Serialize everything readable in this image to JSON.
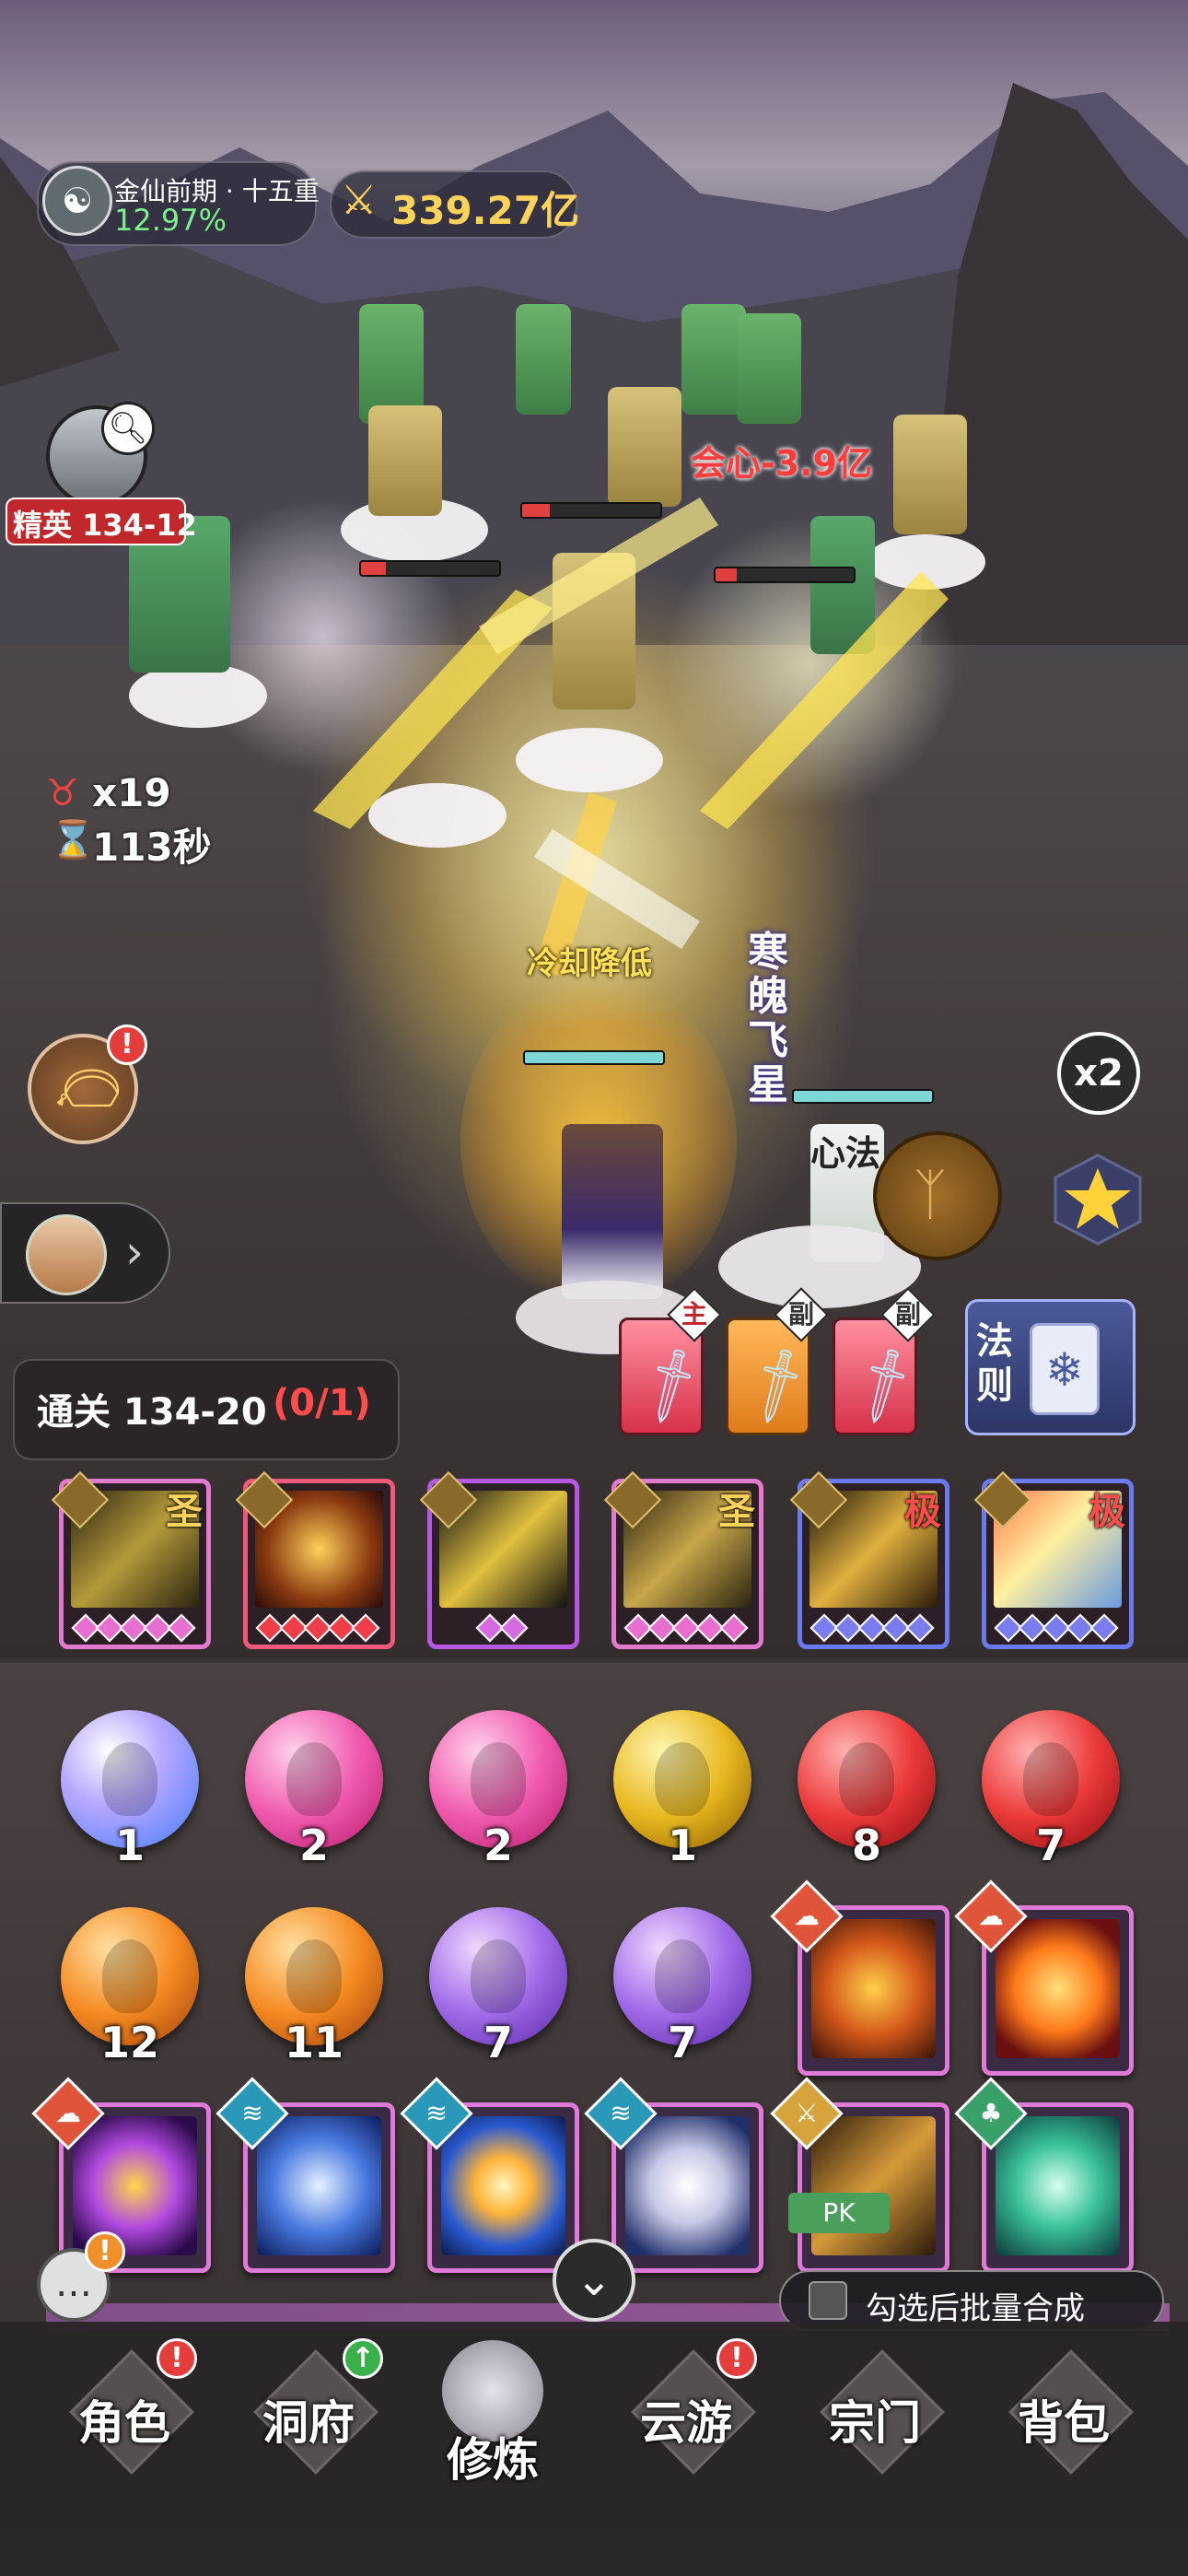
{
  "player": {
    "realm": "金仙前期 · 十五重",
    "progress": "12.97%",
    "power": "339.27亿"
  },
  "stage": {
    "elite_label": "精英 134-12",
    "enemy_count": "x19",
    "timer": "113秒",
    "clear_label": "通关 134-20",
    "clear_progress": "(0/1)"
  },
  "battle": {
    "crit_text": "会心-3.9亿",
    "buff_text": "冷却降低",
    "skill_name": "寒魄飞星",
    "mind_label": "心法",
    "speed": "x2"
  },
  "weapons": {
    "main_label": "主",
    "sub1_label": "副",
    "sub2_label": "副",
    "law_label": "法则"
  },
  "skills": [
    {
      "grade": "圣",
      "gem_color": "#e86fd0",
      "gems": 5
    },
    {
      "grade": "",
      "gem_color": "#ef3d4a",
      "gems": 5
    },
    {
      "grade": "",
      "gem_color": "#d56be0",
      "gems": 2
    },
    {
      "grade": "圣",
      "gem_color": "#e86fd0",
      "gems": 5
    },
    {
      "grade": "极",
      "gem_color": "#7b7cf0",
      "gems": 5
    },
    {
      "grade": "极",
      "gem_color": "#7b7cf0",
      "gems": 5
    }
  ],
  "orbs_row1": [
    "1",
    "2",
    "2",
    "1",
    "8",
    "7"
  ],
  "orbs_row2": [
    "12",
    "11",
    "7",
    "7"
  ],
  "pk_label": "PK",
  "batch_label": "勾选后批量合成",
  "nav": {
    "role": "角色",
    "cave": "洞府",
    "cultivate": "修炼",
    "travel": "云游",
    "sect": "宗门",
    "bag": "背包"
  },
  "colors": {
    "power_gold": "#ffd35a",
    "progress_green": "#7cf08c",
    "elite_red": "#c0282c",
    "clear_red": "#ff4d4d"
  }
}
